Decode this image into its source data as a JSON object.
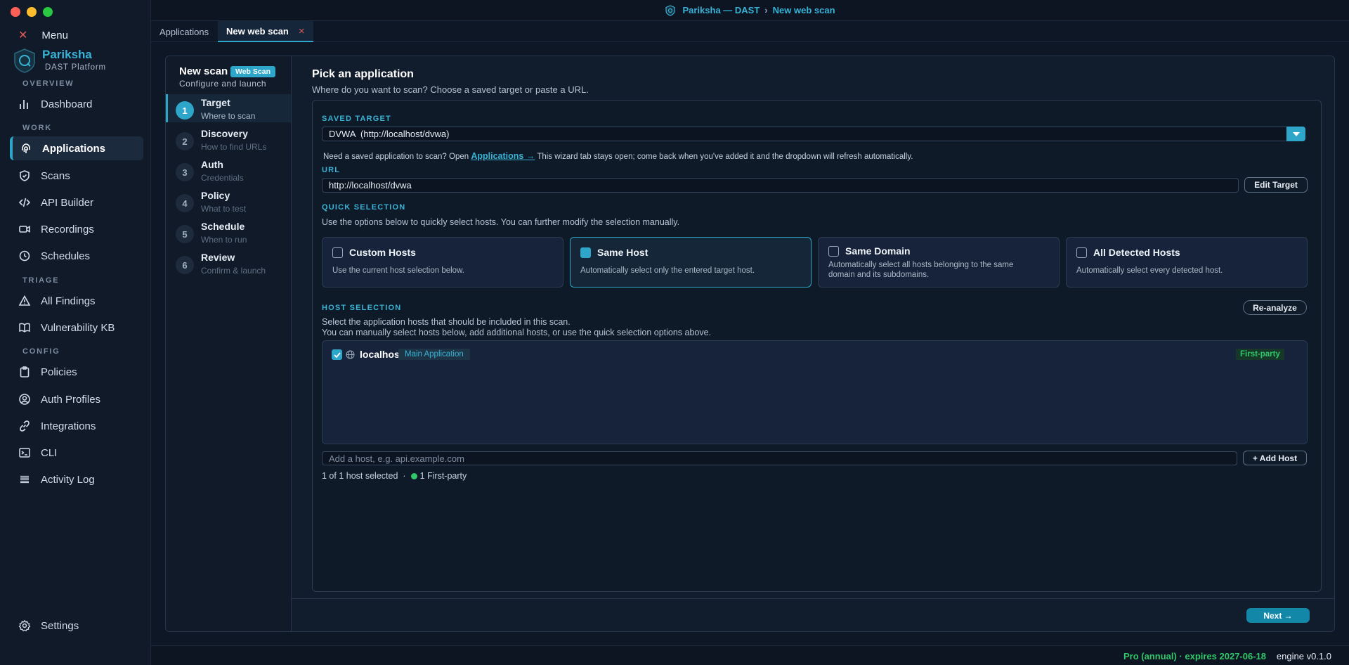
{
  "window": {
    "title": "Pariksha — DAST",
    "crumb_sep": "›",
    "crumb": "New web scan"
  },
  "sidebar": {
    "menu_label": "Menu",
    "brand": "Pariksha",
    "brand_sub": "DAST Platform",
    "sections": {
      "overview": "OVERVIEW",
      "work": "WORK",
      "triage": "TRIAGE",
      "config": "CONFIG"
    },
    "items": {
      "dashboard": "Dashboard",
      "applications": "Applications",
      "scans": "Scans",
      "api_builder": "API Builder",
      "recordings": "Recordings",
      "schedules": "Schedules",
      "all_findings": "All Findings",
      "vulnerability_kb": "Vulnerability KB",
      "policies": "Policies",
      "auth_profiles": "Auth Profiles",
      "integrations": "Integrations",
      "cli": "CLI",
      "activity_log": "Activity Log",
      "settings": "Settings"
    }
  },
  "tabs": [
    {
      "label": "Applications"
    },
    {
      "label": "New web scan",
      "close": "×"
    }
  ],
  "wizard": {
    "title": "New scan",
    "badge": "Web Scan",
    "subtitle": "Configure and launch",
    "steps": [
      {
        "num": "1",
        "title": "Target",
        "sub": "Where to scan"
      },
      {
        "num": "2",
        "title": "Discovery",
        "sub": "How to find URLs"
      },
      {
        "num": "3",
        "title": "Auth",
        "sub": "Credentials"
      },
      {
        "num": "4",
        "title": "Policy",
        "sub": "What to test"
      },
      {
        "num": "5",
        "title": "Schedule",
        "sub": "When to run"
      },
      {
        "num": "6",
        "title": "Review",
        "sub": "Confirm & launch"
      }
    ],
    "next_label": "Next →"
  },
  "target": {
    "heading": "Pick an application",
    "desc": "Where do you want to scan? Choose a saved target or paste a URL.",
    "saved_label": "SAVED TARGET",
    "saved_value": "DVWA  (http://localhost/dvwa)",
    "hint_pre": "Need a saved application to scan? Open",
    "hint_link": "Applications →",
    "hint_post": "This wizard tab stays open; come back when you've added it and the dropdown will refresh automatically.",
    "url_label": "URL",
    "url_value": "http://localhost/dvwa",
    "edit_target": "Edit Target",
    "quick_label": "QUICK SELECTION",
    "quick_desc": "Use the options below to quickly select hosts. You can further modify the selection manually.",
    "quick": [
      {
        "title": "Custom Hosts",
        "desc": "Use the current host selection below.",
        "checked": false
      },
      {
        "title": "Same Host",
        "desc": "Automatically select only the entered target host.",
        "checked": true
      },
      {
        "title": "Same Domain",
        "desc": "Automatically select all hosts belonging to the same domain and its subdomains.",
        "checked": false
      },
      {
        "title": "All Detected Hosts",
        "desc": "Automatically select every detected host.",
        "checked": false
      }
    ],
    "host_label": "HOST SELECTION",
    "reanalyze": "Re-analyze",
    "host_desc1": "Select the application hosts that should be included in this scan.",
    "host_desc2": "You can manually select hosts below, add additional hosts, or use the quick selection options above.",
    "hosts": [
      {
        "name": "localhost",
        "tag": "Main Application",
        "party": "First-party",
        "checked": true
      }
    ],
    "add_placeholder": "Add a host, e.g. api.example.com",
    "add_button": "+ Add Host",
    "summary": "1 of 1 host selected",
    "summary_sep": "·",
    "summary_party": "1 First-party"
  },
  "status": {
    "license": "Pro (annual) · expires 2027-06-18",
    "engine": "engine v0.1.0"
  },
  "colors": {
    "accent": "#2ea6c9",
    "bg": "#0e1726",
    "success": "#31c76a"
  }
}
